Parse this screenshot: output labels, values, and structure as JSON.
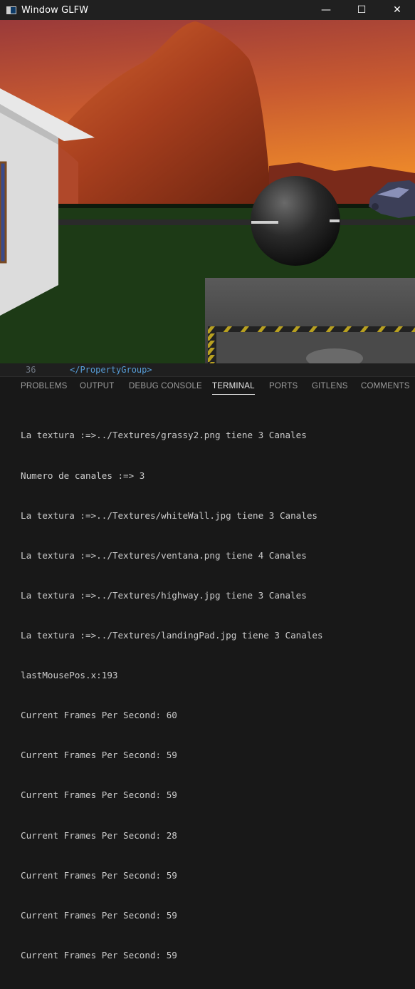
{
  "window": {
    "title": "Window GLFW",
    "minimize_glyph": "—",
    "maximize_glyph": "☐",
    "close_glyph": "✕"
  },
  "editor": {
    "line_number": "36",
    "code_line": "</PropertyGroup>"
  },
  "panel": {
    "tabs": [
      "PROBLEMS",
      "OUTPUT",
      "DEBUG CONSOLE",
      "TERMINAL",
      "PORTS",
      "GITLENS",
      "COMMENTS"
    ],
    "active_tab": "TERMINAL"
  },
  "terminal": {
    "lines": [
      "La textura :=>../Textures/grassy2.png tiene 3 Canales",
      "Numero de canales :=> 3",
      "La textura :=>../Textures/whiteWall.jpg tiene 3 Canales",
      "La textura :=>../Textures/ventana.png tiene 4 Canales",
      "La textura :=>../Textures/highway.jpg tiene 3 Canales",
      "La textura :=>../Textures/landingPad.jpg tiene 3 Canales",
      "lastMousePos.x:193",
      "Current Frames Per Second: 60",
      "Current Frames Per Second: 59",
      "Current Frames Per Second: 59",
      "Current Frames Per Second: 28",
      "Current Frames Per Second: 59",
      "Current Frames Per Second: 59",
      "Current Frames Per Second: 59"
    ]
  },
  "colors": {
    "sky_top": "#b84a2e",
    "sky_bottom": "#e8782a",
    "grass": "#1c3b14",
    "panel_bg": "#181818",
    "titlebar_bg": "#202020"
  }
}
